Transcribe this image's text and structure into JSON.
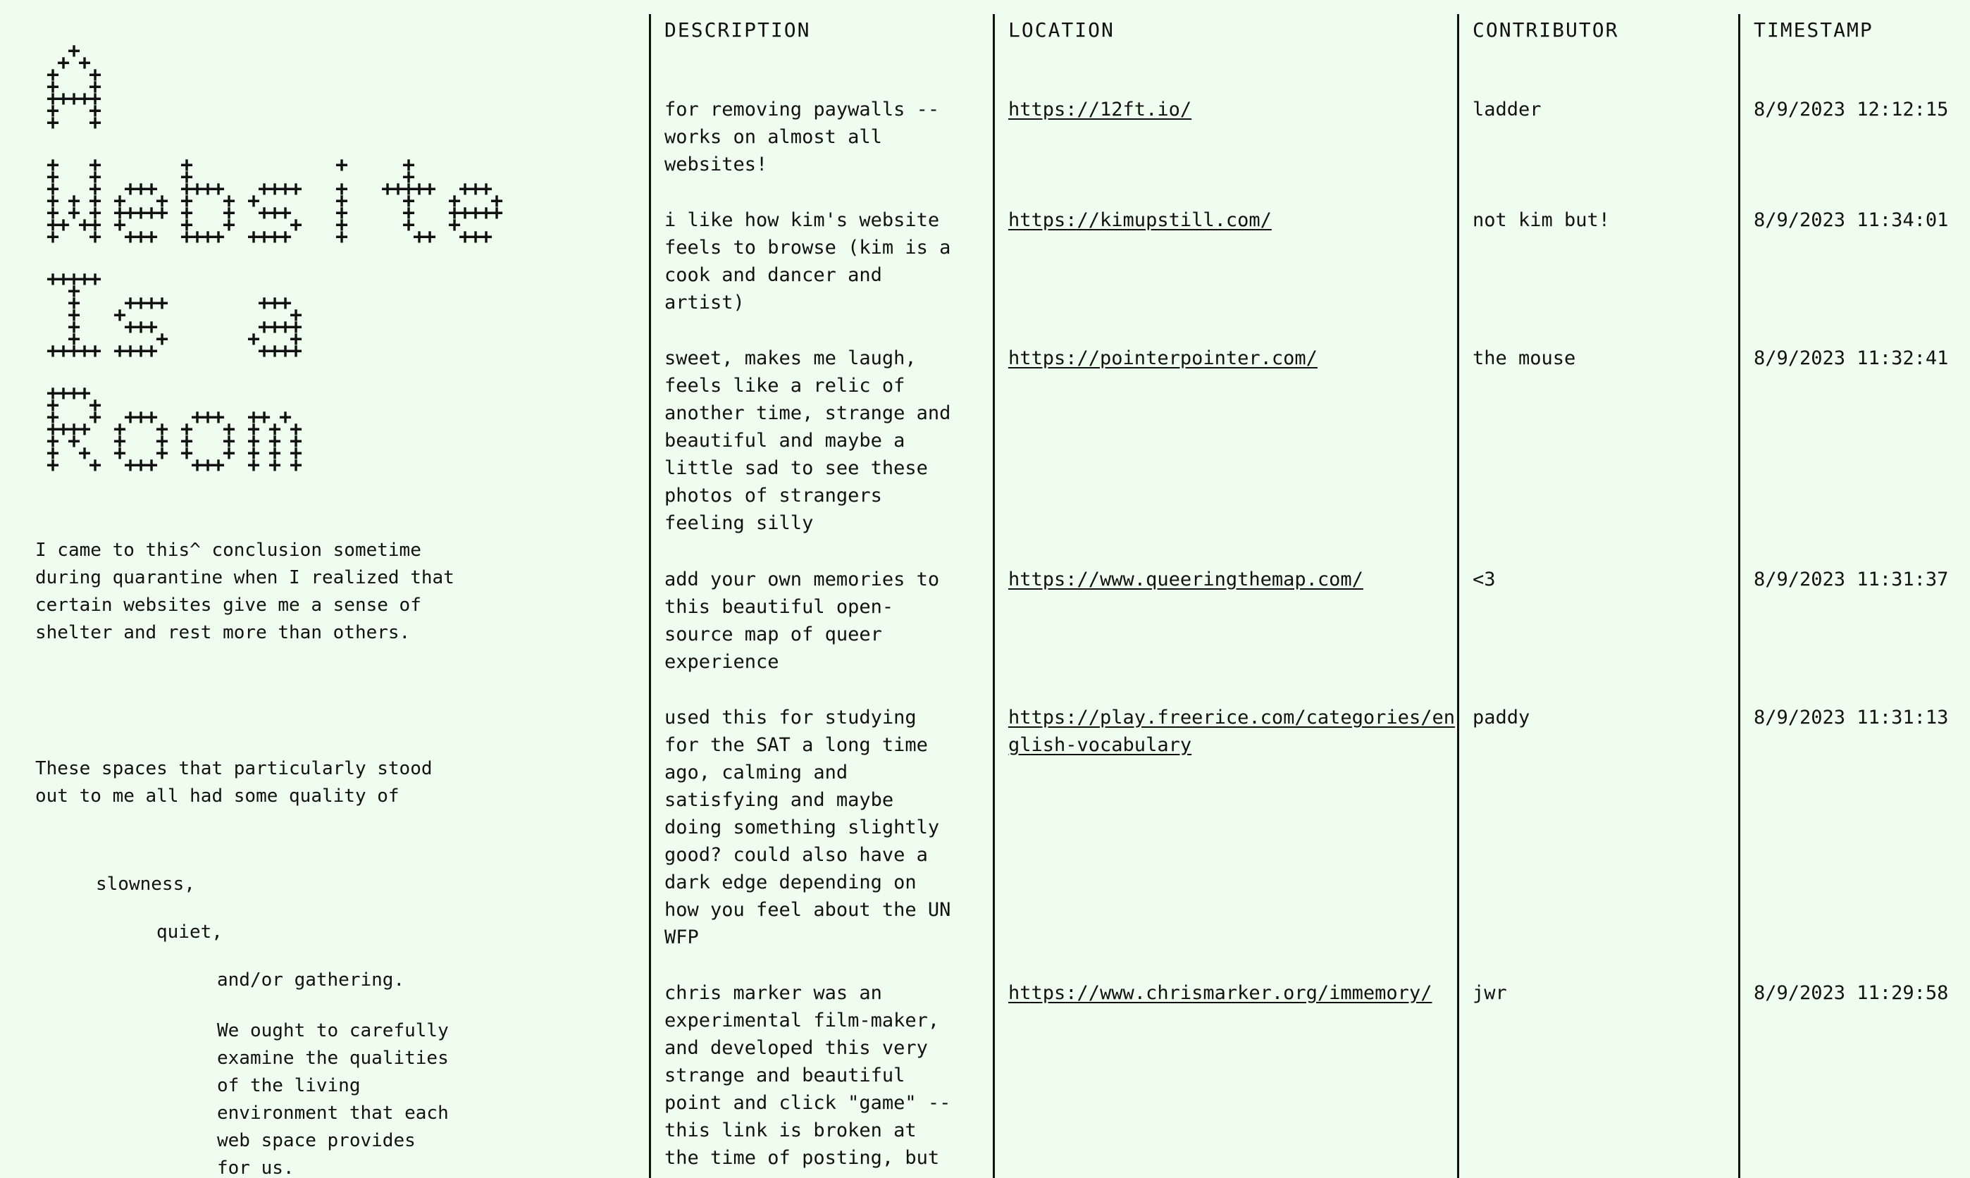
{
  "title_words": [
    "A",
    "Website",
    "Is a",
    "Room"
  ],
  "intro": {
    "paragraph1": "I came to this^ conclusion sometime during quarantine when I realized that certain websites give me a sense of shelter and rest more than others.",
    "paragraph2": "These spaces that particularly stood out to me all had some quality of",
    "quality1": "slowness,",
    "quality2": "quiet,",
    "quality3": "and/or gathering.",
    "paragraph3": "We ought to carefully examine the qualities of the living environment that each web space provides for us."
  },
  "table": {
    "headers": {
      "description": "DESCRIPTION",
      "location": "LOCATION",
      "contributor": "CONTRIBUTOR",
      "timestamp": "TIMESTAMP"
    },
    "rows": [
      {
        "description": "for removing paywalls -- works on almost all websites!",
        "location": "https://12ft.io/",
        "contributor": "ladder",
        "timestamp": "8/9/2023 12:12:15"
      },
      {
        "description": "i like how kim's website feels to browse (kim is a cook and dancer and artist)",
        "location": "https://kimupstill.com/",
        "contributor": "not kim but!",
        "timestamp": "8/9/2023 11:34:01"
      },
      {
        "description": "sweet, makes me laugh, feels like a relic of another time, strange and beautiful and maybe a little sad to see these photos of strangers feeling silly",
        "location": "https://pointerpointer.com/",
        "contributor": "the mouse",
        "timestamp": "8/9/2023 11:32:41"
      },
      {
        "description": "add your own memories to this beautiful open-source map of queer experience",
        "location": "https://www.queeringthemap.com/",
        "contributor": "<3",
        "timestamp": "8/9/2023 11:31:37"
      },
      {
        "description": "used this for studying for the SAT a long time ago, calming and satisfying and maybe doing something slightly good? could also have a dark edge depending on how you feel about the UN WFP",
        "location": "https://play.freerice.com/categories/english-vocabulary",
        "contributor": "paddy",
        "timestamp": "8/9/2023 11:31:13"
      },
      {
        "description": "chris marker was an experimental film-maker, and developed this very strange and beautiful point and click \"game\" -- this link is broken at the time of posting, but",
        "location": "https://www.chrismarker.org/immemory/",
        "contributor": "jwr",
        "timestamp": "8/9/2023 11:29:58"
      }
    ]
  }
}
